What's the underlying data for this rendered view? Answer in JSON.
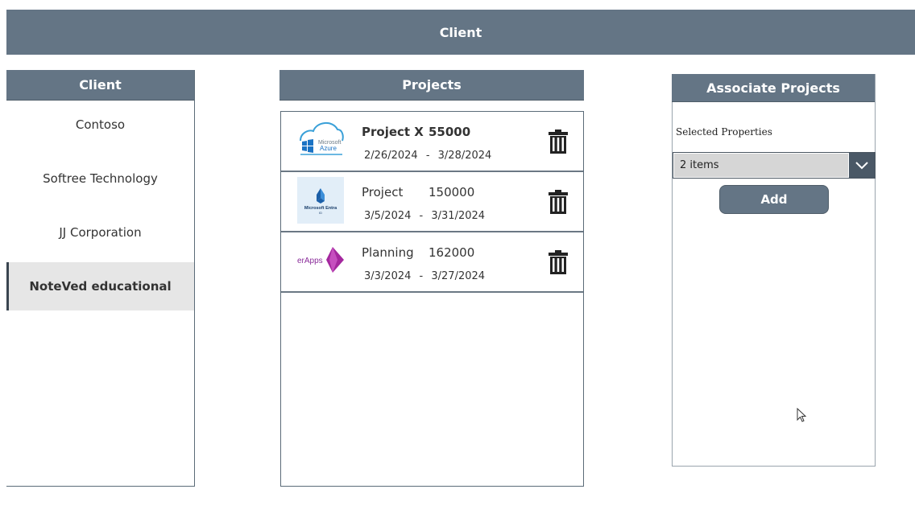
{
  "header": {
    "title": "Client"
  },
  "clients": {
    "title": "Client",
    "items": [
      {
        "label": "Contoso"
      },
      {
        "label": "Softree Technology"
      },
      {
        "label": "JJ Corporation"
      },
      {
        "label": "NoteVed educational"
      }
    ],
    "selected_index": 3
  },
  "projects": {
    "title": "Projects",
    "items": [
      {
        "name": "Project X",
        "amount": "55000",
        "start": "2/26/2024",
        "separator": "-",
        "end": "3/28/2024",
        "thumb": "microsoft-azure-logo",
        "thumb_text": [
          "Microsoft",
          "Azure"
        ],
        "bold": true
      },
      {
        "name": "Project",
        "amount": "150000",
        "start": "3/5/2024",
        "separator": "-",
        "end": "3/31/2024",
        "thumb": "microsoft-entra-logo",
        "thumb_text": [
          "Microsoft Entra",
          "ID"
        ],
        "bold": false
      },
      {
        "name": "Planning",
        "amount": "162000",
        "start": "3/3/2024",
        "separator": "-",
        "end": "3/27/2024",
        "thumb": "power-apps-logo",
        "thumb_text": [
          "erApps"
        ],
        "bold": false
      }
    ]
  },
  "associate": {
    "title": "Associate Projects",
    "field_label": "Selected Properties",
    "combo_value": "2 items",
    "add_label": "Add"
  },
  "colors": {
    "header_bg": "#647585",
    "selected_bg": "#e6e6e6",
    "combo_bg": "#d6d6d6"
  },
  "icons": {
    "delete": "trash-icon",
    "dropdown": "chevron-down-icon",
    "pointer": "mouse-cursor-icon"
  }
}
